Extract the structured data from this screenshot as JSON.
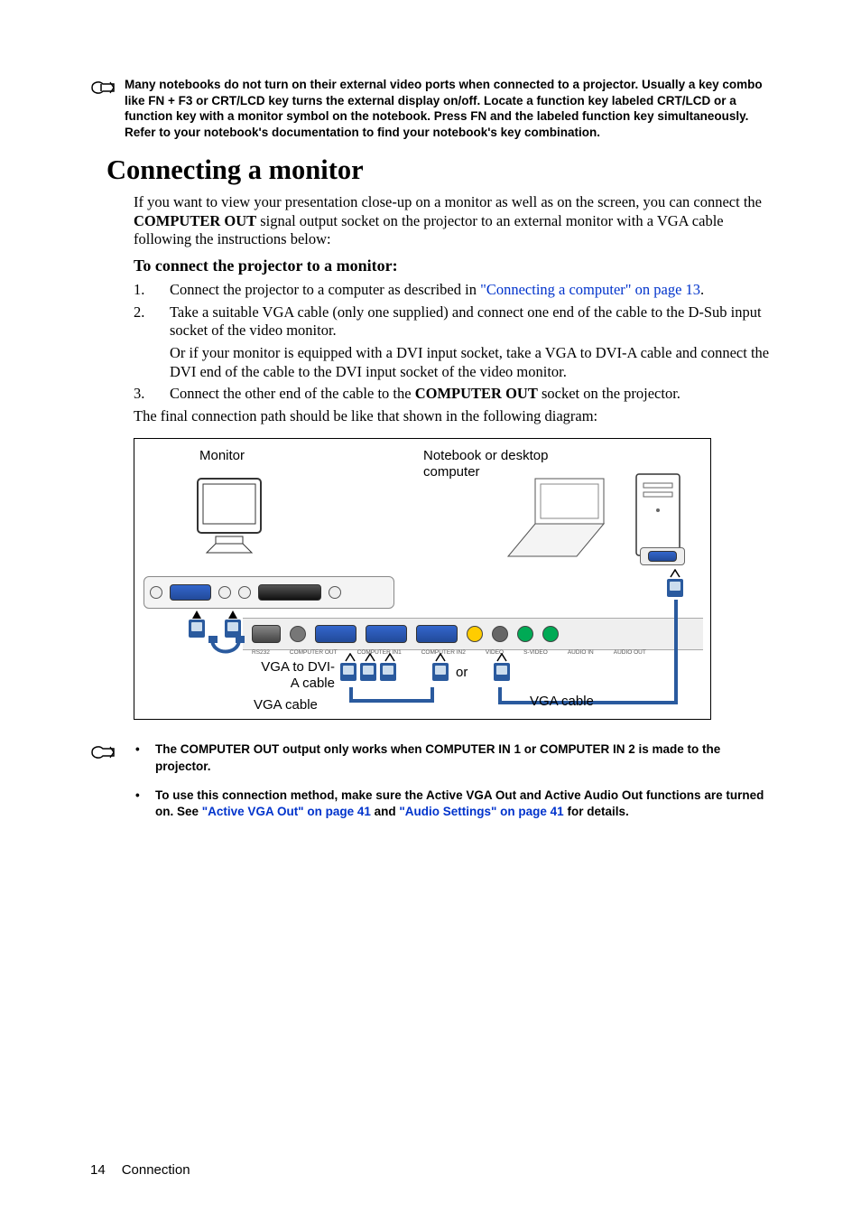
{
  "notes": {
    "top": "Many notebooks do not turn on their external video ports when connected to a projector. Usually a key combo like FN + F3 or CRT/LCD key turns the external display on/off. Locate a function key labeled CRT/LCD or a function key with a monitor symbol on the notebook. Press FN and the labeled function key simultaneously. Refer to your notebook's documentation to find your notebook's key combination."
  },
  "heading1": "Connecting a monitor",
  "intro": {
    "p1a": "If you want to view your presentation close-up on a monitor as well as on the screen, you can connect the ",
    "p1b": "COMPUTER OUT",
    "p1c": " signal output socket on the projector to an external monitor with a VGA cable following the instructions below:"
  },
  "heading2": "To connect the projector to a monitor:",
  "steps": {
    "s1": {
      "num": "1.",
      "pre": "Connect the projector to a computer as described in ",
      "link": "\"Connecting a computer\" on page 13",
      "post": "."
    },
    "s2": {
      "num": "2.",
      "text": "Take a suitable VGA cable (only one supplied) and connect one end of the cable to the D-Sub input socket of the video monitor.",
      "sub": "Or if your monitor is equipped with a DVI input socket, take a VGA to DVI-A cable and connect the DVI end of the cable to the DVI input socket of the video monitor."
    },
    "s3": {
      "num": "3.",
      "pre": "Connect the other end of the cable to the ",
      "b": "COMPUTER OUT",
      "post": " socket on the projector."
    }
  },
  "final_para": "The final connection path should be like that shown in the following diagram:",
  "diagram": {
    "monitor": "Monitor",
    "notebook": "Notebook or desktop computer",
    "vga_dvi": "VGA to DVI-A cable",
    "vga_left": "VGA cable",
    "or": "or",
    "vga_right": "VGA cable",
    "port_labels": [
      "RS232",
      "COMPUTER OUT",
      "COMPUTER IN1",
      "COMPUTER IN2",
      "VIDEO",
      "S-VIDEO",
      "AUDIO IN",
      "AUDIO OUT"
    ]
  },
  "footer_notes": {
    "b1": "The COMPUTER OUT output only works when COMPUTER IN 1 or COMPUTER IN 2 is made to the projector.",
    "b2a": "To use this connection method, make sure the Active VGA Out and Active Audio Out functions are turned on. See ",
    "b2link1": "\"Active VGA Out\" on page 41",
    "b2mid": " and ",
    "b2link2": "\"Audio Settings\" on page 41",
    "b2post": " for details."
  },
  "footer": {
    "page": "14",
    "section": "Connection"
  }
}
